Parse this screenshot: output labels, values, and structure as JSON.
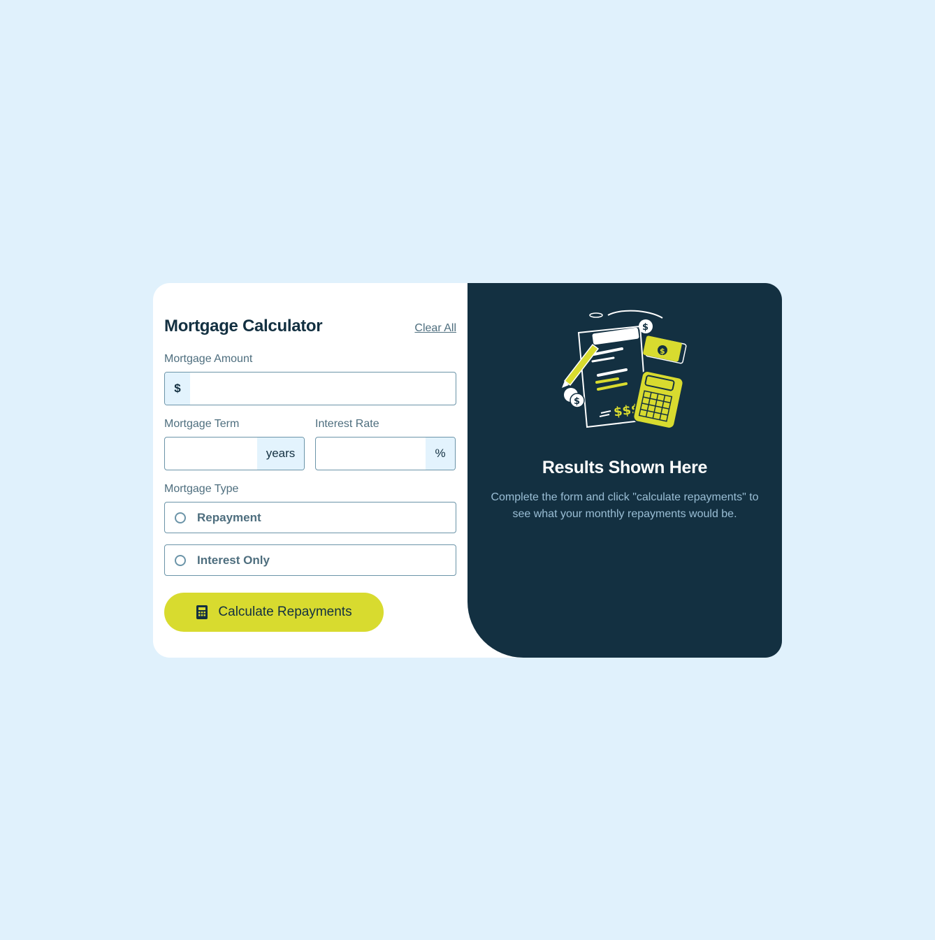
{
  "form": {
    "title": "Mortgage Calculator",
    "clear_all": "Clear All",
    "amount": {
      "label": "Mortgage Amount",
      "prefix": "$",
      "value": ""
    },
    "term": {
      "label": "Mortgage Term",
      "suffix": "years",
      "value": ""
    },
    "rate": {
      "label": "Interest Rate",
      "suffix": "%",
      "value": ""
    },
    "type": {
      "label": "Mortgage Type",
      "options": [
        {
          "label": "Repayment",
          "selected": false
        },
        {
          "label": "Interest Only",
          "selected": false
        }
      ]
    },
    "submit": {
      "label": "Calculate Repayments",
      "icon": "calculator-icon"
    }
  },
  "results": {
    "illustration": "empty-results-illustration",
    "title": "Results Shown Here",
    "description": "Complete the form and click \"calculate repayments\" to see what your monthly repayments would be."
  },
  "colors": {
    "background": "#e0f1fc",
    "accent": "#d8db2f",
    "dark": "#133041",
    "muted": "#4e6e7e",
    "border": "#6b94a8"
  }
}
